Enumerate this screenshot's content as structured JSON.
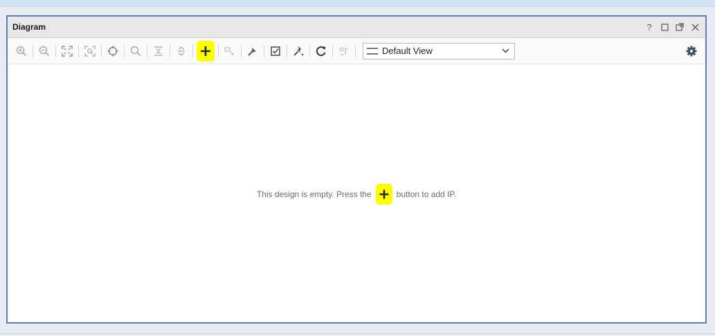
{
  "window": {
    "title": "Diagram",
    "controls": {
      "help": "?",
      "maximize": "□",
      "float": "⧉",
      "close": "✕"
    }
  },
  "toolbar": {
    "buttons": [
      {
        "name": "zoom-in",
        "icon": "zoom-in-icon",
        "enabled": false
      },
      {
        "name": "zoom-out",
        "icon": "zoom-out-icon",
        "enabled": false
      },
      {
        "name": "zoom-fit",
        "icon": "zoom-fit-icon",
        "enabled": false
      },
      {
        "name": "zoom-selection",
        "icon": "zoom-area-icon",
        "enabled": false
      },
      {
        "name": "auto-connect",
        "icon": "crosshair-icon",
        "enabled": false
      },
      {
        "name": "search",
        "icon": "search-icon",
        "enabled": false
      },
      {
        "name": "collapse",
        "icon": "collapse-icon",
        "enabled": false
      },
      {
        "name": "expand",
        "icon": "expand-icon",
        "enabled": false
      },
      {
        "name": "add-ip",
        "icon": "plus-icon",
        "enabled": true,
        "highlighted": true
      },
      {
        "name": "add-module",
        "icon": "module-icon",
        "enabled": false
      },
      {
        "name": "properties",
        "icon": "wrench-icon",
        "enabled": true
      },
      {
        "name": "validate",
        "icon": "checkbox-icon",
        "enabled": true
      },
      {
        "name": "pin",
        "icon": "pin-icon",
        "enabled": true
      },
      {
        "name": "regenerate",
        "icon": "refresh-icon",
        "enabled": true
      },
      {
        "name": "optimize-routing",
        "icon": "routing-icon",
        "enabled": false
      }
    ],
    "view_select": {
      "selected": "Default View"
    }
  },
  "canvas": {
    "empty_message_before": "This design is empty. Press the",
    "empty_message_after": "button to add IP."
  },
  "colors": {
    "panel_border": "#5b7db1",
    "highlight": "#ffff00",
    "title_bg": "#e8e8e8"
  }
}
